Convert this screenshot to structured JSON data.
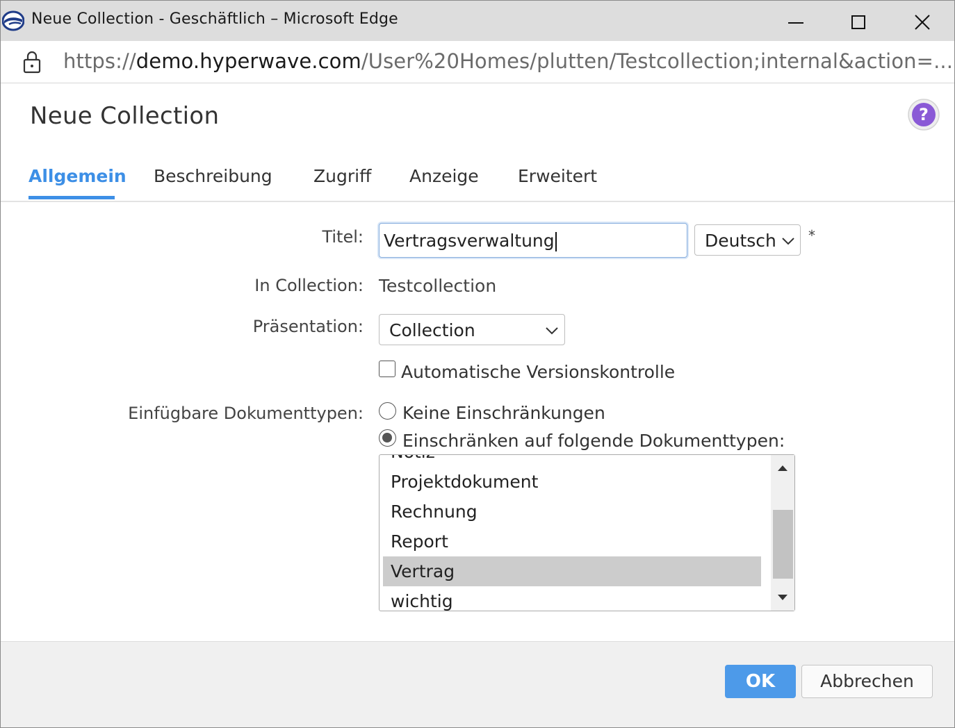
{
  "window": {
    "title": "Neue Collection - Geschäftlich – Microsoft Edge"
  },
  "address_bar": {
    "scheme": "https://",
    "host": "demo.hyperwave.com",
    "path": "/User%20Homes/plutten/Testcollection;internal&action=..."
  },
  "dialog": {
    "title": "Neue Collection"
  },
  "tabs": [
    {
      "label": "Allgemein",
      "active": true
    },
    {
      "label": "Beschreibung",
      "active": false
    },
    {
      "label": "Zugriff",
      "active": false
    },
    {
      "label": "Anzeige",
      "active": false
    },
    {
      "label": "Erweitert",
      "active": false
    }
  ],
  "form": {
    "title_label": "Titel:",
    "title_value": "Vertragsverwaltung",
    "language_value": "Deutsch",
    "required_marker": "*",
    "in_collection_label": "In Collection:",
    "in_collection_value": "Testcollection",
    "presentation_label": "Präsentation:",
    "presentation_value": "Collection",
    "auto_versioning_label": "Automatische Versionskontrolle",
    "auto_versioning_checked": false,
    "doc_types_label": "Einfügbare Dokumenttypen:",
    "radio_no_restriction": "Keine Einschränkungen",
    "radio_restrict": "Einschränken auf folgende Dokumenttypen:",
    "restrict_selected": true,
    "doc_types": [
      "Notiz",
      "Projektdokument",
      "Rechnung",
      "Report",
      "Vertrag",
      "wichtig"
    ],
    "doc_types_selected": "Vertrag"
  },
  "buttons": {
    "ok": "OK",
    "cancel": "Abbrechen"
  },
  "colors": {
    "accent": "#3d8fe6",
    "ok_button": "#4d9ae9",
    "help_icon": "#8a5ad6",
    "selected_row": "#cccccc"
  }
}
